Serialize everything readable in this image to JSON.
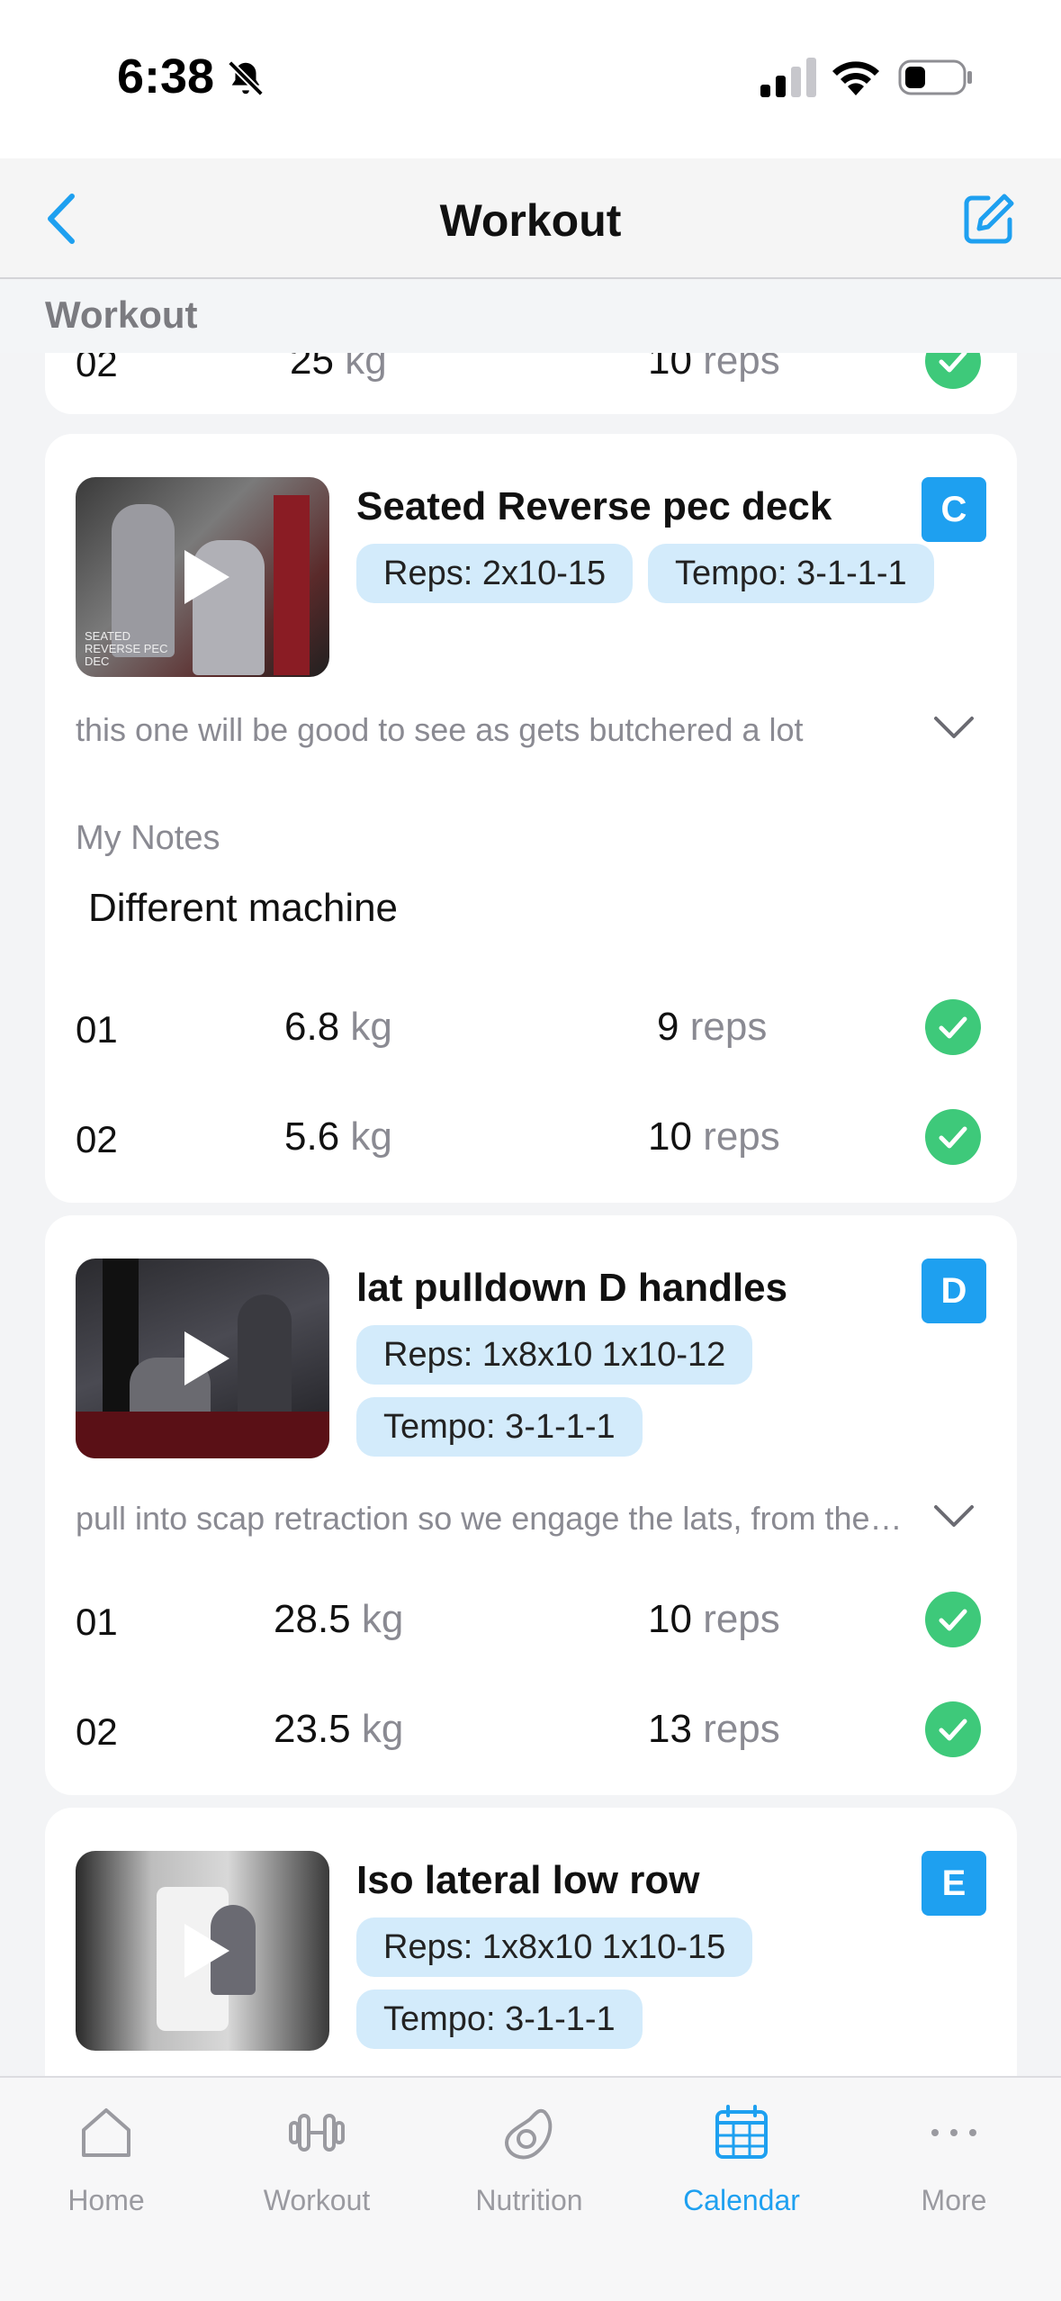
{
  "status": {
    "time": "6:38"
  },
  "nav": {
    "title": "Workout"
  },
  "section": {
    "title": "Workout"
  },
  "prev_card": {
    "sets": [
      {
        "num": "02",
        "weight": "25",
        "unit": "kg",
        "reps": "10",
        "reps_unit": "reps"
      }
    ]
  },
  "exercises": [
    {
      "title": "Seated Reverse pec deck",
      "badge": "C",
      "reps": "Reps: 2x10-15",
      "tempo": "Tempo: 3-1-1-1",
      "thumb_caption": "SEATED REVERSE PEC DEC",
      "description": "this one will be good to see as gets butchered a lot",
      "notes_label": "My Notes",
      "notes": "Different machine",
      "sets": [
        {
          "num": "01",
          "weight": "6.8",
          "unit": "kg",
          "reps": "9",
          "reps_unit": "reps"
        },
        {
          "num": "02",
          "weight": "5.6",
          "unit": "kg",
          "reps": "10",
          "reps_unit": "reps"
        }
      ]
    },
    {
      "title": "lat pulldown D handles",
      "badge": "D",
      "reps": "Reps: 1x8x10 1x10-12",
      "tempo": "Tempo: 3-1-1-1",
      "description": "pull into scap retraction so we engage the lats, from the top",
      "sets": [
        {
          "num": "01",
          "weight": "28.5",
          "unit": "kg",
          "reps": "10",
          "reps_unit": "reps"
        },
        {
          "num": "02",
          "weight": "23.5",
          "unit": "kg",
          "reps": "13",
          "reps_unit": "reps"
        }
      ]
    },
    {
      "title": "Iso lateral low row",
      "badge": "E",
      "reps": "Reps: 1x8x10 1x10-15",
      "tempo": "Tempo: 3-1-1-1"
    }
  ],
  "tabs": [
    {
      "label": "Home",
      "icon": "home-icon"
    },
    {
      "label": "Workout",
      "icon": "dumbbell-icon"
    },
    {
      "label": "Nutrition",
      "icon": "avocado-icon"
    },
    {
      "label": "Calendar",
      "icon": "calendar-icon"
    },
    {
      "label": "More",
      "icon": "more-icon"
    }
  ],
  "colors": {
    "accent": "#1ea0f0",
    "chip": "#d3ebfb",
    "check": "#3ec97a"
  }
}
